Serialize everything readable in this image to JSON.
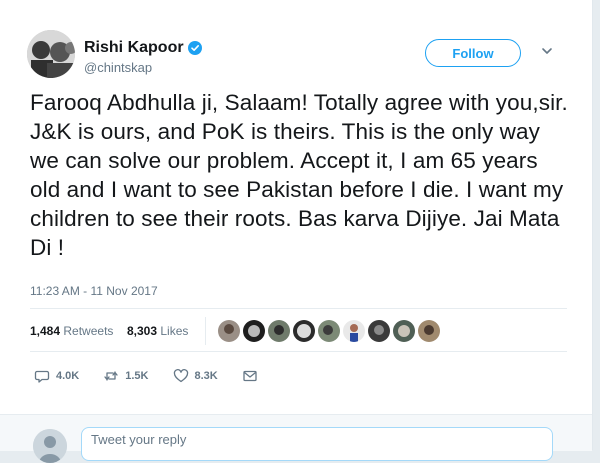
{
  "user": {
    "display_name": "Rishi Kapoor",
    "handle": "@chintskap",
    "verified": true
  },
  "follow_button": {
    "label": "Follow"
  },
  "tweet": {
    "text": "Farooq Abdhulla ji, Salaam! Totally agree with you,sir. J&K is ours, and PoK is theirs. This is the only way we can solve our problem. Accept it, I am 65 years old and I want to see Pakistan before I die. I want my children to see their roots. Bas karva Dijiye. Jai Mata Di !",
    "timestamp": "11:23 AM - 11 Nov 2017"
  },
  "stats": {
    "retweets_count": "1,484",
    "retweets_label": "Retweets",
    "likes_count": "8,303",
    "likes_label": "Likes"
  },
  "actions": {
    "reply_count": "4.0K",
    "retweet_count": "1.5K",
    "like_count": "8.3K"
  },
  "reply": {
    "placeholder": "Tweet your reply"
  },
  "colors": {
    "accent": "#1da1f2",
    "secondary_text": "#657786",
    "primary_text": "#14171a"
  },
  "icons": [
    "verified-badge-icon",
    "chevron-down-icon",
    "reply-icon",
    "retweet-icon",
    "like-icon",
    "direct-message-icon"
  ]
}
